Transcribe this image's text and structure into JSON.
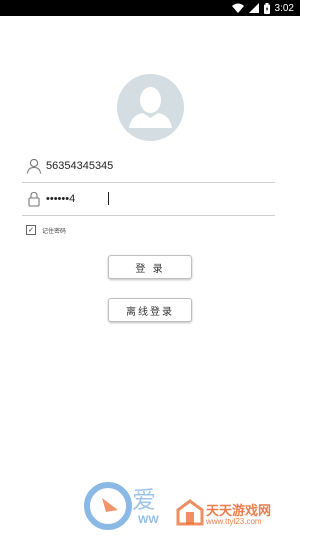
{
  "status_bar": {
    "time": "3:02",
    "icons": [
      "wifi-icon",
      "signal-icon",
      "battery-icon"
    ]
  },
  "avatar": {
    "icon": "user-avatar-icon"
  },
  "login_form": {
    "username": {
      "icon": "user-icon",
      "value": "56354345345"
    },
    "password": {
      "icon": "lock-icon",
      "value": "••••••4"
    },
    "remember_password": {
      "label": "记住密码",
      "checked": true
    },
    "login_button": "登 录",
    "offline_login_button": "离线登录"
  },
  "watermark": {
    "left_text": "爱",
    "left_sub": "WW",
    "brand": "天天游戏网",
    "url": "www.ttyl23.com"
  },
  "colors": {
    "accent_text": "#3a7ca8",
    "avatar_bg": "#d4dde1",
    "watermark_blue": "#2c7fd0",
    "watermark_orange": "#e8682c"
  }
}
